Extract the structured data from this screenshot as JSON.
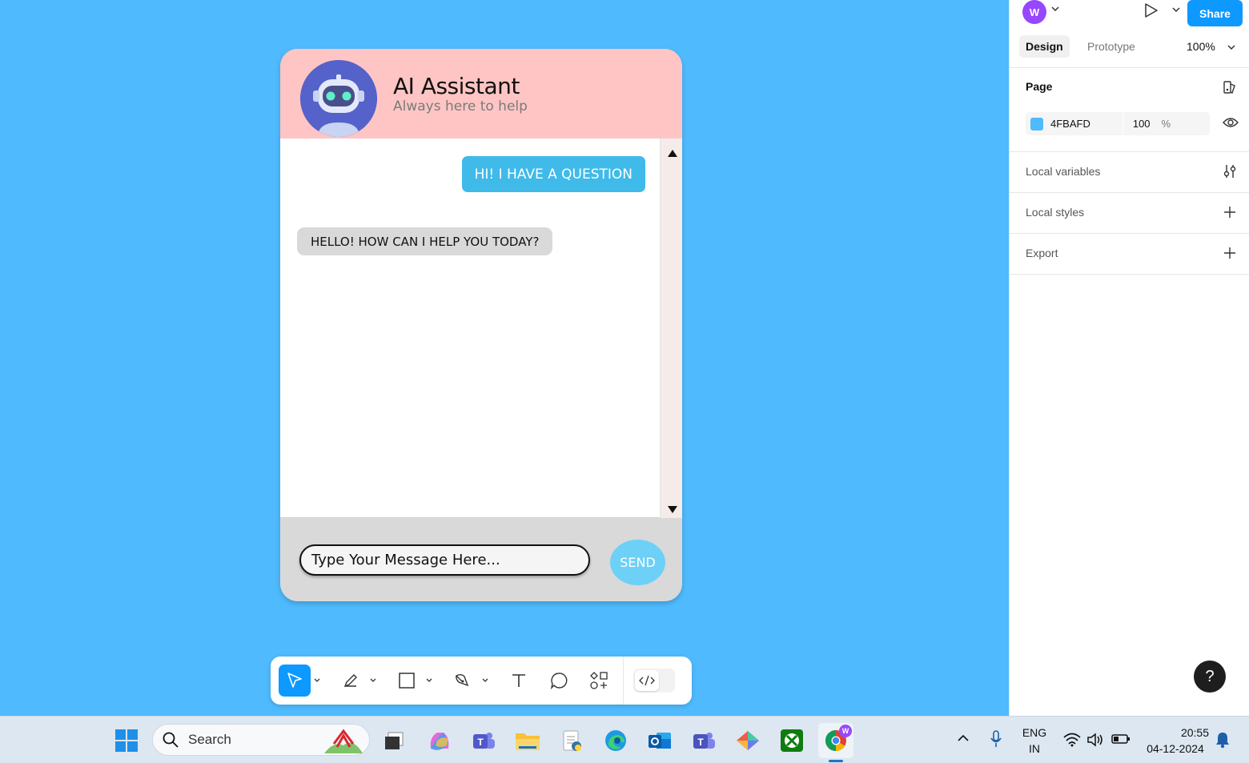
{
  "canvas": {
    "background": "#4FBAFD",
    "chat": {
      "title": "AI Assistant",
      "subtitle": "Always here to help",
      "messages": [
        {
          "role": "user",
          "text": "HI! I HAVE A QUESTION"
        },
        {
          "role": "bot",
          "text": "HELLO! HOW CAN I HELP YOU TODAY?"
        }
      ],
      "input_placeholder": "Type Your Message Here...",
      "send_label": "SEND"
    },
    "toolbar": {
      "tools": [
        "move-tool",
        "pencil-tool",
        "frame-tool",
        "pen-tool",
        "text-tool",
        "comment-tool",
        "actions-tool"
      ],
      "dev_mode_icon": "code-icon"
    }
  },
  "panel": {
    "user_initial": "W",
    "share_label": "Share",
    "tabs": {
      "design": "Design",
      "prototype": "Prototype"
    },
    "zoom": "100%",
    "page_section": "Page",
    "page_color": {
      "hex": "4FBAFD",
      "opacity": "100",
      "unit": "%"
    },
    "local_variables": "Local variables",
    "local_styles": "Local styles",
    "export": "Export",
    "help": "?"
  },
  "taskbar": {
    "search_label": "Search",
    "language": {
      "line1": "ENG",
      "line2": "IN"
    },
    "time": "20:55",
    "date": "04-12-2024",
    "chrome_badge": "W",
    "apps": [
      "start-icon",
      "task-view-icon",
      "copilot-icon",
      "teams-icon",
      "file-explorer-icon",
      "notepad-icon",
      "edge-icon",
      "outlook-icon",
      "teams-work-icon",
      "app-icon",
      "xbox-icon",
      "chrome-icon"
    ]
  }
}
